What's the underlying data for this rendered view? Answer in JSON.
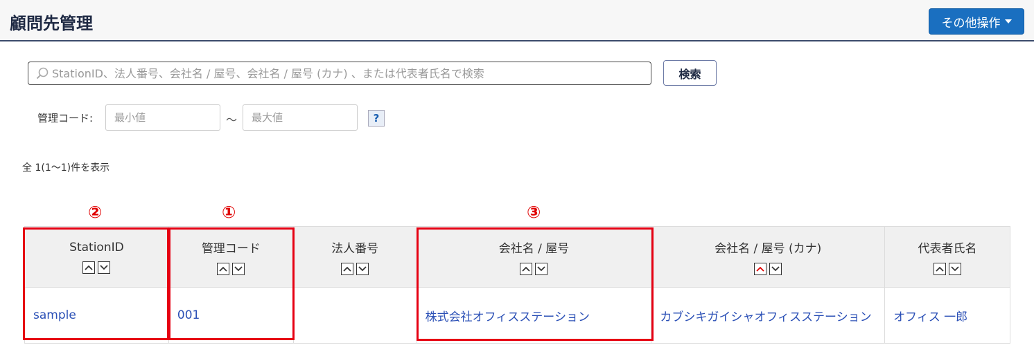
{
  "header": {
    "title": "顧問先管理",
    "ops_label": "その他操作"
  },
  "search": {
    "placeholder": "StationID、法人番号、会社名 / 屋号、会社名 / 屋号 (カナ) 、または代表者氏名で検索",
    "button_label": "検索"
  },
  "code_filter": {
    "label": "管理コード:",
    "min_placeholder": "最小値",
    "max_placeholder": "最大値",
    "separator": "〜",
    "help": "?"
  },
  "result_count": "全 1(1〜1)件を表示",
  "markers": [
    "②",
    "①",
    "③"
  ],
  "table": {
    "columns": [
      "StationID",
      "管理コード",
      "法人番号",
      "会社名 / 屋号",
      "会社名 / 屋号 (カナ)",
      "代表者氏名"
    ],
    "rows": [
      [
        "sample",
        "001",
        "",
        "株式会社オフィスステーション",
        "カブシキガイシャオフィスステーション",
        "オフィス 一郎"
      ]
    ]
  },
  "colors": {
    "accent": "#1a6fc0",
    "highlight": "#e60012",
    "link": "#2b50b6",
    "active_sort": "#e00000"
  }
}
